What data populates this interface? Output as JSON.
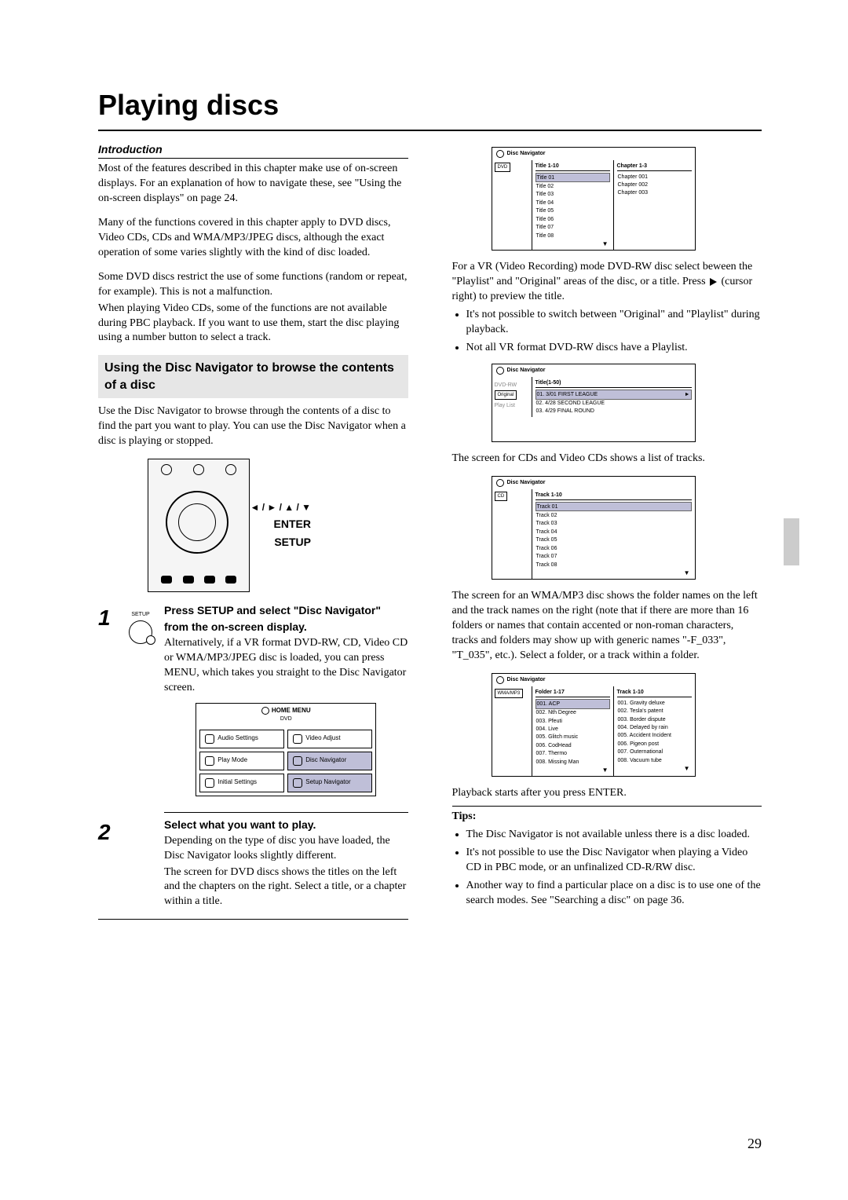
{
  "page_number": "29",
  "title": "Playing discs",
  "intro_heading": "Introduction",
  "intro_p1": "Most of the features described in this chapter make use of on-screen displays. For an explanation of how to navigate these, see \"Using the on-screen displays\" on page 24.",
  "intro_p2": "Many of the functions covered in this chapter apply to DVD discs, Video CDs, CDs and WMA/MP3/JPEG discs, although the exact operation of some varies slightly with the kind of disc loaded.",
  "intro_p3": "Some DVD discs restrict the use of some functions (random or repeat, for example). This is not a malfunction.",
  "intro_p4": "When playing Video CDs, some of the functions are not available during PBC playback. If you want to use them, start the disc playing using a number button to select a track.",
  "shade_heading": "Using the Disc Navigator to browse the contents of a disc",
  "nav_intro": "Use the Disc Navigator to browse through the contents of a disc to find the part you want to play. You can use the Disc Navigator when a disc is playing or stopped.",
  "remote": {
    "arrows": "◄ / ► / ▲ / ▼",
    "enter": "ENTER",
    "setup": "SETUP"
  },
  "step1": {
    "num": "1",
    "icon_label": "SETUP",
    "bold": "Press SETUP and select \"Disc Navigator\" from the on-screen display.",
    "body": "Alternatively, if a VR format DVD-RW, CD, Video CD or WMA/MP3/JPEG disc is loaded, you can press MENU, which takes you straight to the Disc Navigator screen."
  },
  "home_menu": {
    "title": "HOME MENU",
    "subtitle": "DVD",
    "items": [
      "Audio Settings",
      "Video Adjust",
      "Play Mode",
      "Disc Navigator",
      "Initial Settings",
      "Setup Navigator"
    ]
  },
  "step2": {
    "num": "2",
    "bold": "Select what you want to play.",
    "body1": "Depending on the type of disc you have loaded, the Disc Navigator looks slightly different.",
    "body2": "The screen for DVD discs shows the titles on the left and the chapters on the right. Select a title, or a chapter within a title."
  },
  "nav_dvd": {
    "label": "Disc Navigator",
    "tag": "DVD",
    "left_header": "Title 1-10",
    "right_header": "Chapter 1-3",
    "titles": [
      "Title 01",
      "Title 02",
      "Title 03",
      "Title 04",
      "Title 05",
      "Title 06",
      "Title 07",
      "Title 08"
    ],
    "chapters": [
      "Chapter 001",
      "Chapter 002",
      "Chapter 003"
    ]
  },
  "vr_p1_a": "For a VR (Video Recording) mode DVD-RW disc select beween the \"Playlist\" and \"Original\" areas of the disc, or a title. Press ",
  "vr_p1_b": " (cursor right) to preview the title.",
  "vr_bullets": [
    "It's not possible to switch between \"Original\" and \"Playlist\" during playback.",
    "Not all VR format DVD-RW discs have a Playlist."
  ],
  "nav_vr": {
    "label": "Disc Navigator",
    "side1": "DVD-RW",
    "side2": "Original",
    "side3": "Play List",
    "header": "Title(1-50)",
    "titles": [
      "01. 3/01 FIRST LEAGUE",
      "02. 4/28 SECOND LEAGUE",
      "03. 4/29 FINAL ROUND"
    ]
  },
  "cd_intro": "The screen for CDs and Video CDs shows a list of tracks.",
  "nav_cd": {
    "label": "Disc Navigator",
    "tag": "CD",
    "header": "Track 1-10",
    "tracks": [
      "Track 01",
      "Track 02",
      "Track 03",
      "Track 04",
      "Track 05",
      "Track 06",
      "Track 07",
      "Track 08"
    ]
  },
  "mp3_intro": "The screen for an WMA/MP3 disc shows the folder names on the left and the track names on the right (note that if there are more than 16 folders or names that contain accented or non-roman characters, tracks and folders may show up with generic names \"-F_033\", \"T_035\", etc.). Select a folder, or a track within a folder.",
  "nav_mp3": {
    "label": "Disc Navigator",
    "tag": "WMA/MP3",
    "left_header": "Folder 1-17",
    "right_header": "Track 1-10",
    "folders": [
      "001. ACP",
      "002. Nth Degree",
      "003. Pfeuti",
      "004. Live",
      "005. Glitch music",
      "006. CodHead",
      "007. Thermo",
      "008. Missing Man"
    ],
    "tracks": [
      "001. Gravity deluxe",
      "002. Tesla's patent",
      "003. Border dispute",
      "004. Delayed by rain",
      "005. Accident Incident",
      "006. Pigeon post",
      "007. Outernational",
      "008. Vacuum tube"
    ]
  },
  "after": "Playback starts after you press ENTER.",
  "tips_h": "Tips:",
  "tips": [
    "The Disc Navigator is not available unless there is a disc loaded.",
    "It's not possible to use the Disc Navigator when playing a Video CD in PBC mode, or an unfinalized CD-R/RW disc.",
    "Another way to find a particular place on a disc is to use one of the search modes. See \"Searching a disc\" on page 36."
  ]
}
